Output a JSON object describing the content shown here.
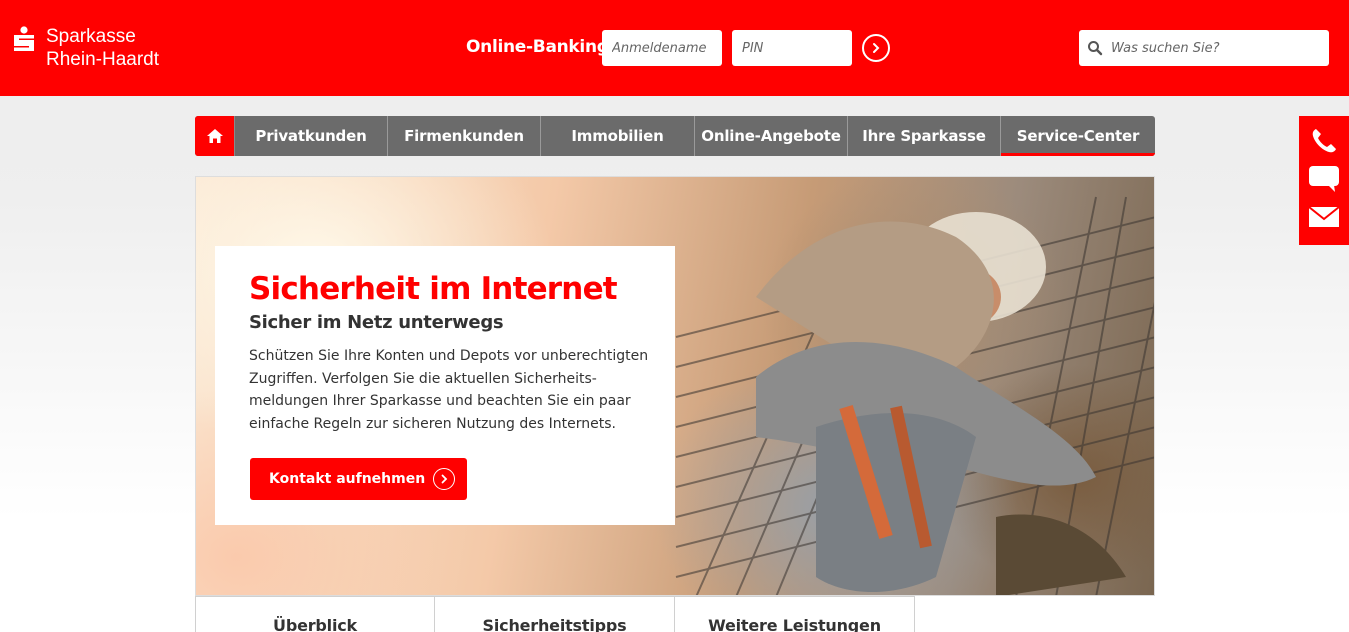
{
  "brand": {
    "line1": "Sparkasse",
    "line2": "Rhein-Haardt",
    "color": "#ff0000"
  },
  "online_banking": {
    "label": "Online-Banking",
    "username_placeholder": "Anmeldename",
    "pin_placeholder": "PIN",
    "submit_icon": "chevron-right-circle-icon"
  },
  "search": {
    "placeholder": "Was suchen Sie?",
    "icon": "search-icon"
  },
  "nav": {
    "home_icon": "home-icon",
    "items": [
      {
        "label": "Privatkunden"
      },
      {
        "label": "Firmenkunden"
      },
      {
        "label": "Immobilien"
      },
      {
        "label": "Online-Angebote"
      },
      {
        "label": "Ihre Sparkasse"
      },
      {
        "label": "Service-Center",
        "active": true
      }
    ]
  },
  "side_contact": {
    "icons": [
      "phone-icon",
      "chat-icon",
      "mail-icon"
    ]
  },
  "teaser": {
    "title": "Sicherheit im Internet",
    "subtitle": "Sicher im Netz unterwegs",
    "text": "Schützen Sie Ihre Konten und Depots vor unberechtigten Zugriffen. Verfolgen Sie die aktuellen Sicherheits-meldungen Ihrer Sparkasse und beachten Sie ein paar einfache Regeln zur sicheren Nutzung des Internets.",
    "cta_label": "Kontakt aufnehmen"
  },
  "subtabs": [
    {
      "label": "Überblick"
    },
    {
      "label": "Sicherheitstipps"
    },
    {
      "label": "Weitere Leistungen"
    }
  ]
}
